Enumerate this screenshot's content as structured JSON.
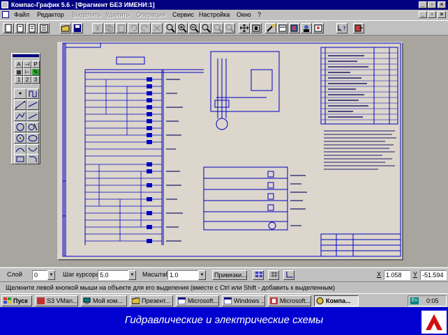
{
  "window": {
    "title": "Компас-График 5.6 - [Фрагмент БЕЗ ИМЕНИ:1]"
  },
  "menu": {
    "items": [
      {
        "label": "Файл",
        "enabled": true
      },
      {
        "label": "Редактор",
        "enabled": true
      },
      {
        "label": "Выделить",
        "enabled": false
      },
      {
        "label": "Удалить",
        "enabled": false
      },
      {
        "label": "Операции",
        "enabled": false
      },
      {
        "label": "Сервис",
        "enabled": true
      },
      {
        "label": "Настройка",
        "enabled": true
      },
      {
        "label": "Окно",
        "enabled": true
      },
      {
        "label": "?",
        "enabled": true
      }
    ]
  },
  "palette": {
    "tabs": [
      "1",
      "2",
      "3"
    ]
  },
  "status": {
    "layer_label": "Слой",
    "layer_value": "0",
    "step_label": "Шаг курсора",
    "step_value": "5.0",
    "scale_label": "Масштаб",
    "scale_value": "1.0",
    "snap_label": "Привязки...",
    "x_label": "X",
    "x_value": "1.058",
    "y_label": "Y",
    "y_value": "-51.594"
  },
  "hint": "Щелкните левой кнопкой мыши на объекте для его выделения (вместе с Ctrl или Shift - добавить к выделенным)",
  "taskbar": {
    "start_label": "Пуск",
    "tasks": [
      {
        "label": "S3 VMan..."
      },
      {
        "label": "Мой ком..."
      },
      {
        "label": "Презент..."
      },
      {
        "label": "Microsoft..."
      },
      {
        "label": "Windows ..."
      },
      {
        "label": "Microsoft..."
      },
      {
        "label": "Компа..."
      }
    ],
    "lang": "En",
    "clock": "0:05"
  },
  "banner": {
    "caption": "Гидравлические и электрические схемы"
  }
}
